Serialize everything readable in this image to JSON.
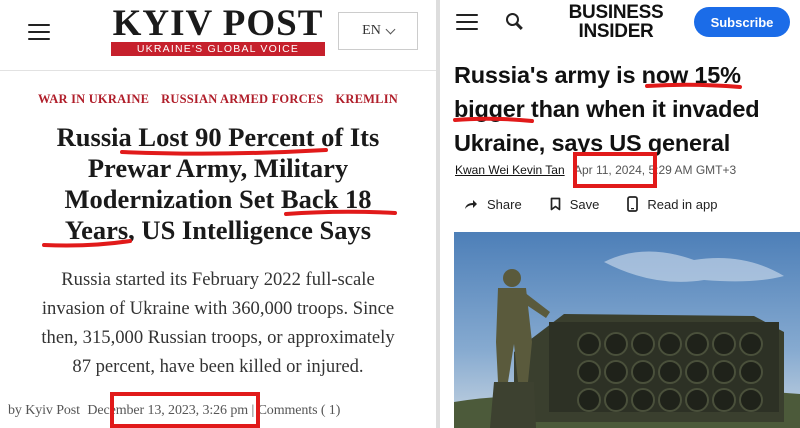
{
  "kyiv_post": {
    "logo": "KYIV POST",
    "tagline": "UKRAINE'S GLOBAL VOICE",
    "language_selector": "EN",
    "tags": [
      "WAR IN UKRAINE",
      "RUSSIAN ARMED FORCES",
      "KREMLIN"
    ],
    "headline_lines": [
      "Russia Lost 90 Percent of Its",
      "Prewar Army, Military",
      "Modernization Set Back 18",
      "Years, US Intelligence Says"
    ],
    "dek_lines": [
      "Russia started its February 2022 full-scale",
      "invasion of Ukraine with 360,000 troops. Since",
      "then, 315,000 Russian troops, or approximately",
      "87 percent, have been killed or injured."
    ],
    "byline": {
      "author": "by Kyiv Post",
      "date": "December 13, 2023,",
      "time": "3:26 pm",
      "comments": "| Comments ( 1)"
    }
  },
  "business_insider": {
    "logo_line1": "BUSINESS",
    "logo_line2": "INSIDER",
    "subscribe_label": "Subscribe",
    "headline_lines": [
      "Russia's army is now 15%",
      "bigger than when it invaded",
      "Ukraine, says US general"
    ],
    "author": "Kwan Wei Kevin Tan",
    "date": "Apr 11, 2024,",
    "time": "5:29 AM GMT+3",
    "actions": {
      "share": "Share",
      "save": "Save",
      "read_in_app": "Read in app"
    }
  },
  "colors": {
    "annotation_red": "#e11a1a",
    "kyiv_post_red": "#c6202c",
    "subscribe_blue": "#1b6ce8"
  }
}
